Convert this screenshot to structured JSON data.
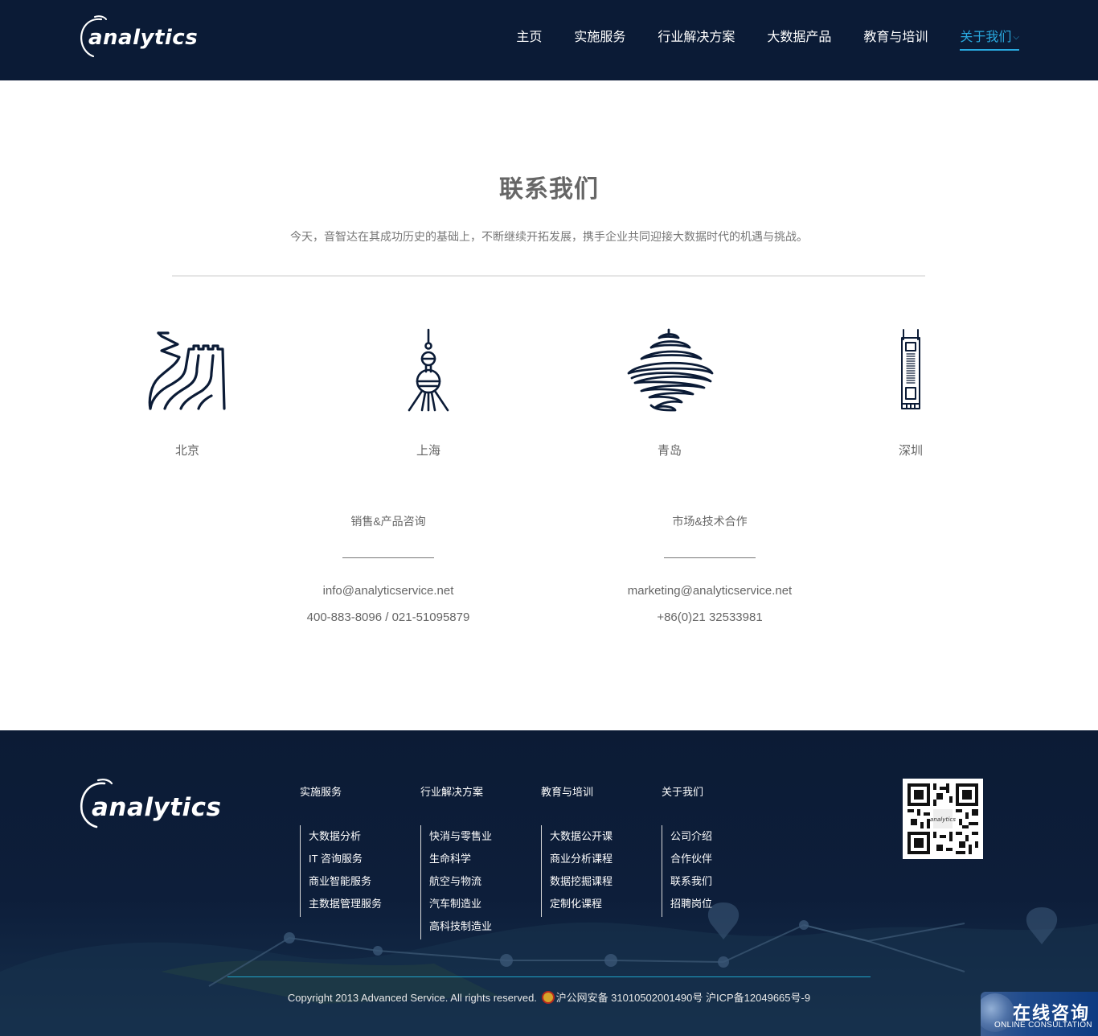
{
  "header": {
    "logo_text": "analytics",
    "nav": [
      {
        "label": "主页"
      },
      {
        "label": "实施服务"
      },
      {
        "label": "行业解决方案"
      },
      {
        "label": "大数据产品"
      },
      {
        "label": "教育与培训"
      },
      {
        "label": "关于我们",
        "active": true
      }
    ]
  },
  "main": {
    "title": "联系我们",
    "intro": "今天，音智达在其成功历史的基础上，不断继续开拓发展，携手企业共同迎接大数据时代的机遇与挑战。",
    "cities": [
      {
        "name": "北京",
        "icon": "great-wall-icon"
      },
      {
        "name": "上海",
        "icon": "oriental-pearl-tower-icon"
      },
      {
        "name": "青岛",
        "icon": "qingdao-sculpture-icon"
      },
      {
        "name": "深圳",
        "icon": "skyscraper-icon"
      }
    ],
    "contacts": [
      {
        "heading": "销售&产品咨询",
        "email": "info@analyticservice.net",
        "phone": "400-883-8096 / 021-51095879"
      },
      {
        "heading": "市场&技术合作",
        "email": "marketing@analyticservice.net",
        "phone": "+86(0)21 32533981"
      }
    ]
  },
  "footer": {
    "logo_text": "analytics",
    "columns": [
      {
        "heading": "实施服务",
        "items": [
          "大数据分析",
          "IT 咨询服务",
          "商业智能服务",
          "主数据管理服务"
        ]
      },
      {
        "heading": "行业解决方案",
        "items": [
          "快消与零售业",
          "生命科学",
          "航空与物流",
          "汽车制造业",
          "高科技制造业"
        ]
      },
      {
        "heading": "教育与培训",
        "items": [
          "大数据公开课",
          "商业分析课程",
          "数据挖掘课程",
          "定制化课程"
        ]
      },
      {
        "heading": "关于我们",
        "items": [
          "公司介绍",
          "合作伙伴",
          "联系我们",
          "招聘岗位"
        ]
      }
    ],
    "copyright": "Copyright 2013 Advanced Service. All rights reserved.",
    "icp": "沪公网安备 31010502001490号 沪ICP备12049665号-9"
  },
  "consult_widget": {
    "title": "在线咨询",
    "subtitle": "ONLINE CONSULTATION"
  },
  "colors": {
    "header_bg": "#0b1b36",
    "footer_bg": "#0c1b35",
    "accent": "#29a9df"
  }
}
